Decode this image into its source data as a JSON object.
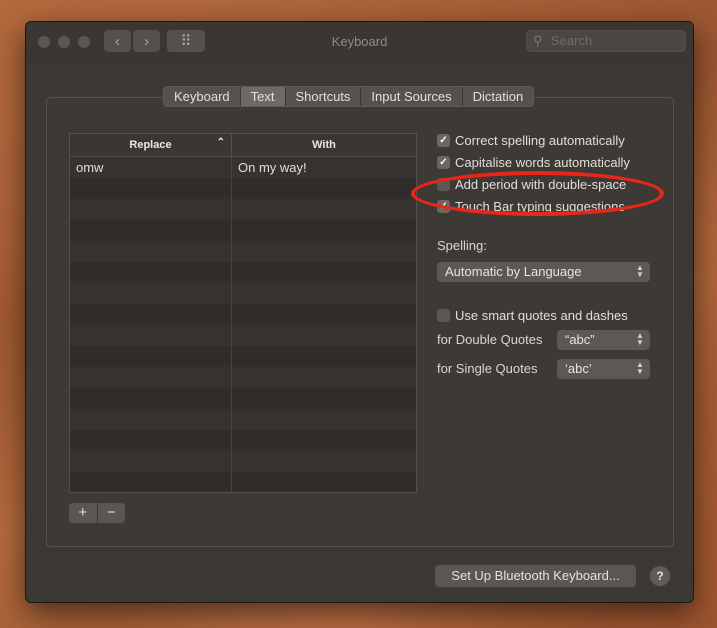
{
  "window": {
    "title": "Keyboard",
    "search_placeholder": "Search",
    "nav_back": "‹",
    "nav_forward": "›",
    "grid_icon": "⠿"
  },
  "tabs": [
    {
      "label": "Keyboard",
      "active": false
    },
    {
      "label": "Text",
      "active": true
    },
    {
      "label": "Shortcuts",
      "active": false
    },
    {
      "label": "Input Sources",
      "active": false
    },
    {
      "label": "Dictation",
      "active": false
    }
  ],
  "table": {
    "columns": {
      "replace": "Replace",
      "with": "With"
    },
    "sort_indicator": "⌃",
    "rows": [
      {
        "replace": "omw",
        "with": "On my way!"
      }
    ]
  },
  "controls": {
    "add": "+",
    "remove": "−"
  },
  "options": {
    "correct_spelling": {
      "label": "Correct spelling automatically",
      "checked": true
    },
    "capitalise_words": {
      "label": "Capitalise words automatically",
      "checked": true
    },
    "add_period": {
      "label": "Add period with double-space",
      "checked": false
    },
    "touch_bar": {
      "label": "Touch Bar typing suggestions",
      "checked": true
    }
  },
  "spelling": {
    "label": "Spelling:",
    "value": "Automatic by Language"
  },
  "smart_quotes": {
    "label": "Use smart quotes and dashes",
    "checked": false
  },
  "double_quotes": {
    "label": "for Double Quotes",
    "value": "“abc”"
  },
  "single_quotes": {
    "label": "for Single Quotes",
    "value": "‘abc’"
  },
  "bluetooth_button": "Set Up Bluetooth Keyboard...",
  "help_button": "?",
  "colors": {
    "highlight": "#e8261a",
    "window": "#3c3834"
  }
}
